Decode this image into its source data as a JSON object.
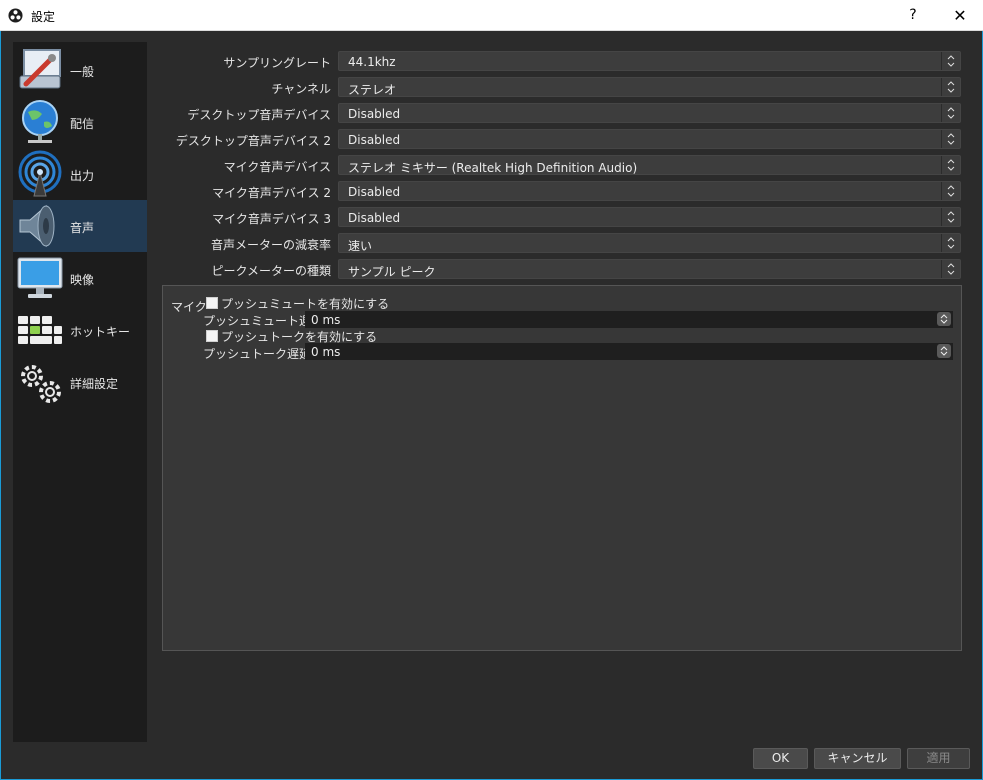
{
  "window": {
    "title": "設定",
    "help": "?",
    "close": "✕"
  },
  "sidebar": {
    "items": [
      {
        "label": "一般",
        "icon": "general-icon",
        "active": false
      },
      {
        "label": "配信",
        "icon": "stream-globe-icon",
        "active": false
      },
      {
        "label": "出力",
        "icon": "output-antenna-icon",
        "active": false
      },
      {
        "label": "音声",
        "icon": "speaker-icon",
        "active": true
      },
      {
        "label": "映像",
        "icon": "monitor-icon",
        "active": false
      },
      {
        "label": "ホットキー",
        "icon": "keyboard-icon",
        "active": false
      },
      {
        "label": "詳細設定",
        "icon": "gears-icon",
        "active": false
      }
    ]
  },
  "audio": {
    "rows": [
      {
        "label": "サンプリングレート",
        "value": "44.1khz"
      },
      {
        "label": "チャンネル",
        "value": "ステレオ"
      },
      {
        "label": "デスクトップ音声デバイス",
        "value": "Disabled"
      },
      {
        "label": "デスクトップ音声デバイス 2",
        "value": "Disabled"
      },
      {
        "label": "マイク音声デバイス",
        "value": "ステレオ ミキサー (Realtek High Definition Audio)"
      },
      {
        "label": "マイク音声デバイス 2",
        "value": "Disabled"
      },
      {
        "label": "マイク音声デバイス 3",
        "value": "Disabled"
      },
      {
        "label": "音声メーターの減衰率",
        "value": "速い"
      },
      {
        "label": "ピークメーターの種類",
        "value": "サンプル ピーク"
      }
    ]
  },
  "hotkeys": {
    "source_label": "マイク",
    "push_to_mute": {
      "label": "プッシュミュートを有効にする",
      "checked": false
    },
    "push_to_mute_delay": {
      "label": "プッシュミュート遅延",
      "value": "0 ms"
    },
    "push_to_talk": {
      "label": "プッシュトークを有効にする",
      "checked": false
    },
    "push_to_talk_delay": {
      "label": "プッシュトーク遅延",
      "value": "0 ms"
    }
  },
  "buttons": {
    "ok": "OK",
    "cancel": "キャンセル",
    "apply": "適用"
  },
  "colors": {
    "accent": "#1a9bd6",
    "active_nav": "#223a52",
    "background": "#2b2b2b"
  }
}
